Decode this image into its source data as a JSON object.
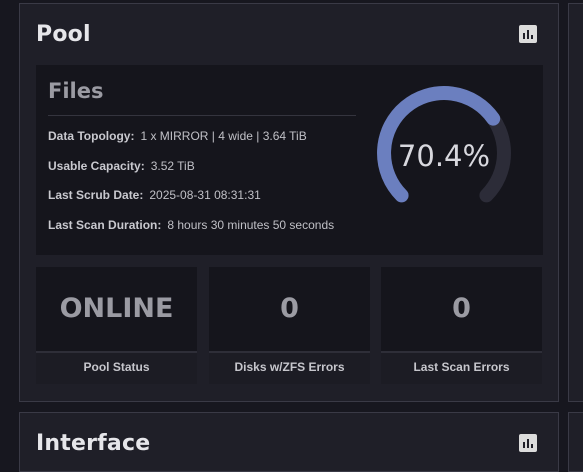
{
  "pool_card": {
    "title": "Pool",
    "chart_button_icon": "bar-chart-icon",
    "files": {
      "title": "Files",
      "rows": [
        {
          "label": "Data Topology:",
          "value": "1 x MIRROR | 4 wide | 3.64 TiB"
        },
        {
          "label": "Usable Capacity:",
          "value": "3.52 TiB"
        },
        {
          "label": "Last Scrub Date:",
          "value": "2025-08-31 08:31:31"
        },
        {
          "label": "Last Scan Duration:",
          "value": "8 hours 30 minutes 50 seconds"
        }
      ],
      "usage": {
        "percent_text": "70.4%",
        "fraction": 0.704,
        "fill_color": "#6b7fbf",
        "track_color": "#2c2c38"
      }
    },
    "stats": [
      {
        "value": "ONLINE",
        "label": "Pool Status"
      },
      {
        "value": "0",
        "label": "Disks w/ZFS Errors"
      },
      {
        "value": "0",
        "label": "Last Scan Errors"
      }
    ]
  },
  "interface_card": {
    "title": "Interface",
    "chart_button_icon": "bar-chart-icon"
  }
}
